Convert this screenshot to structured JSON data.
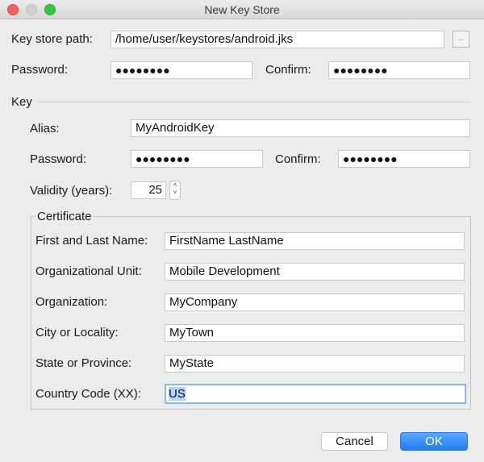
{
  "window": {
    "title": "New Key Store"
  },
  "keystore": {
    "path_label": "Key store path:",
    "path_value": "/home/user/keystores/android.jks",
    "browse_label": "...",
    "password_label": "Password:",
    "password_value": "●●●●●●●●",
    "confirm_label": "Confirm:",
    "confirm_value": "●●●●●●●●"
  },
  "key": {
    "section_label": "Key",
    "alias_label": "Alias:",
    "alias_value": "MyAndroidKey",
    "password_label": "Password:",
    "password_value": "●●●●●●●●",
    "confirm_label": "Confirm:",
    "confirm_value": "●●●●●●●●",
    "validity_label": "Validity (years):",
    "validity_value": "25",
    "spinner_up": "˄",
    "spinner_down": "˅"
  },
  "certificate": {
    "group_label": "Certificate",
    "fields": [
      {
        "label": "First and Last Name:",
        "value": "FirstName LastName"
      },
      {
        "label": "Organizational Unit:",
        "value": "Mobile Development"
      },
      {
        "label": "Organization:",
        "value": "MyCompany"
      },
      {
        "label": "City or Locality:",
        "value": "MyTown"
      },
      {
        "label": "State or Province:",
        "value": "MyState"
      },
      {
        "label": "Country Code (XX):",
        "value": "US"
      }
    ]
  },
  "buttons": {
    "cancel": "Cancel",
    "ok": "OK"
  },
  "colors": {
    "accent": "#1f7df5",
    "selection": "#b3d4fc",
    "focus_ring": "#8fb6ec"
  }
}
